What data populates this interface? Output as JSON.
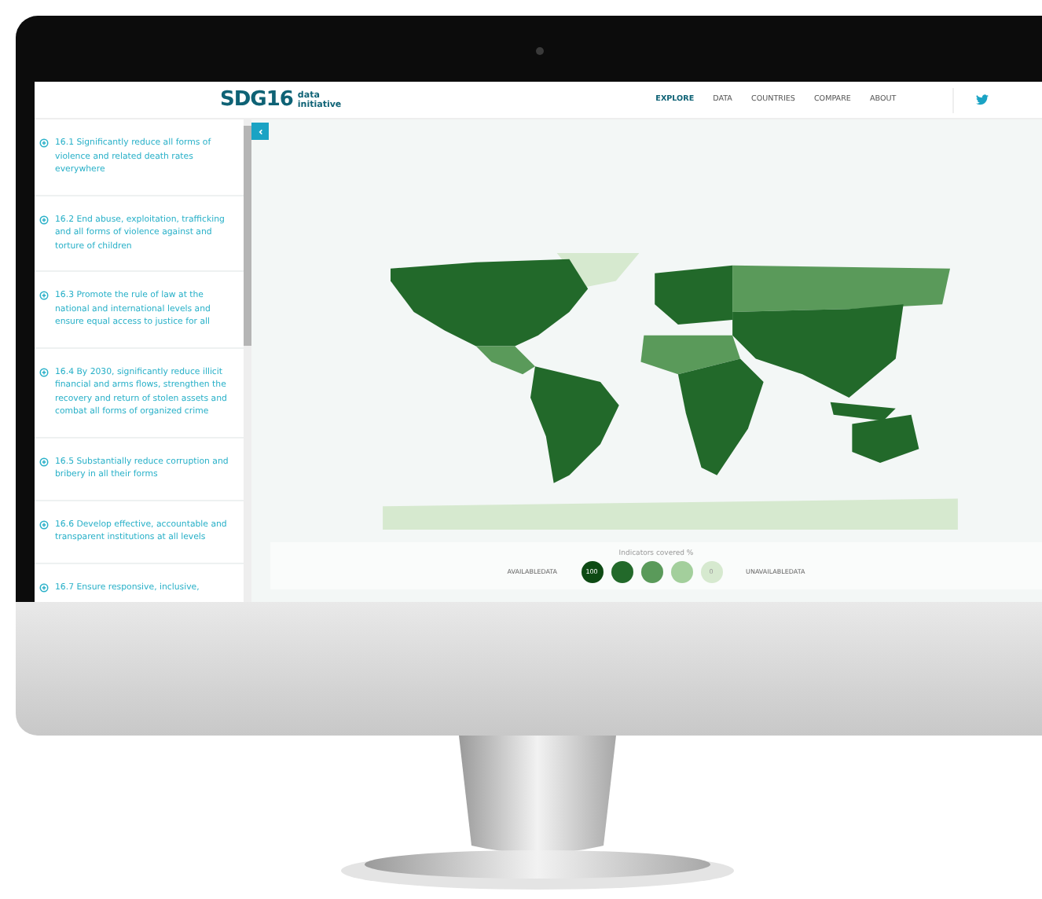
{
  "header": {
    "logo": {
      "mark": "SDG16",
      "line_1": "data",
      "line_2": "initiative"
    },
    "nav": [
      {
        "label": "EXPLORE",
        "selected": true
      },
      {
        "label": "DATA",
        "selected": false
      },
      {
        "label": "COUNTRIES",
        "selected": false
      },
      {
        "label": "COMPARE",
        "selected": false
      },
      {
        "label": "ABOUT",
        "selected": false
      }
    ]
  },
  "sidebar": {
    "items": [
      {
        "text": "16.1 Significantly reduce all forms of violence and related death rates everywhere"
      },
      {
        "text": "16.2 End abuse, exploitation, trafficking and all forms of violence against and torture of children"
      },
      {
        "text": "16.3 Promote the rule of law at the national and international levels and ensure equal access to justice for all"
      },
      {
        "text": "16.4 By 2030, significantly reduce illicit financial and arms flows, strengthen the recovery and return of stolen assets and combat all forms of organized crime"
      },
      {
        "text": "16.5 Substantially reduce corruption and bribery in all their forms"
      },
      {
        "text": "16.6 Develop effective, accountable and transparent institutions at all levels"
      },
      {
        "text": "16.7 Ensure responsive, inclusive,"
      }
    ]
  },
  "legend": {
    "title": "Indicators covered %",
    "left_label": "AVAILABLEDATA",
    "right_label": "UNAVAILABLEDATA",
    "levels": [
      {
        "label": "100",
        "color": "#0d4a14"
      },
      {
        "color": "#22692a"
      },
      {
        "color": "#5a9a5a"
      },
      {
        "color": "#a3cf9c"
      },
      {
        "label": "0",
        "color": "#d6e9cf"
      }
    ]
  }
}
